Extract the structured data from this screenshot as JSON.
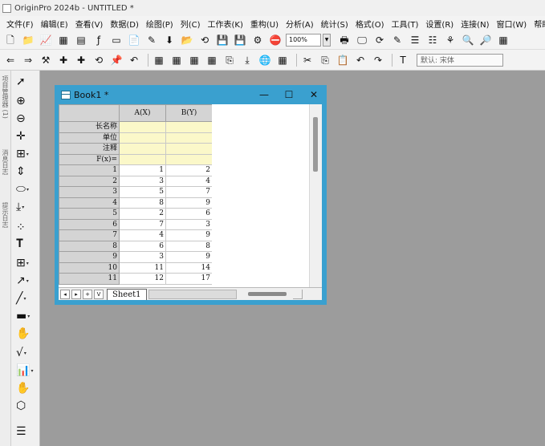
{
  "app": {
    "title": "OriginPro 2024b - UNTITLED *"
  },
  "menu": [
    "文件(F)",
    "编辑(E)",
    "查看(V)",
    "数据(D)",
    "绘图(P)",
    "列(C)",
    "工作表(K)",
    "重构(U)",
    "分析(A)",
    "统计(S)",
    "格式(O)",
    "工具(T)",
    "设置(R)",
    "连接(N)",
    "窗口(W)",
    "帮助(H)"
  ],
  "toolbar": {
    "zoom": "100%",
    "font": "默认: 宋体"
  },
  "left_tabs": [
    "项目管理器 (1)",
    "消息日志",
    "提示日志"
  ],
  "book": {
    "title": "Book1 *",
    "columns": [
      "A(X)",
      "B(Y)"
    ],
    "meta_rows": [
      "长名称",
      "单位",
      "注释",
      "F(x)="
    ],
    "rows": [
      [
        1,
        1,
        2
      ],
      [
        2,
        3,
        4
      ],
      [
        3,
        5,
        7
      ],
      [
        4,
        8,
        9
      ],
      [
        5,
        2,
        6
      ],
      [
        6,
        7,
        3
      ],
      [
        7,
        4,
        9
      ],
      [
        8,
        6,
        8
      ],
      [
        9,
        3,
        9
      ],
      [
        10,
        11,
        14
      ],
      [
        11,
        12,
        17
      ]
    ],
    "sheet_tab": "Sheet1"
  }
}
